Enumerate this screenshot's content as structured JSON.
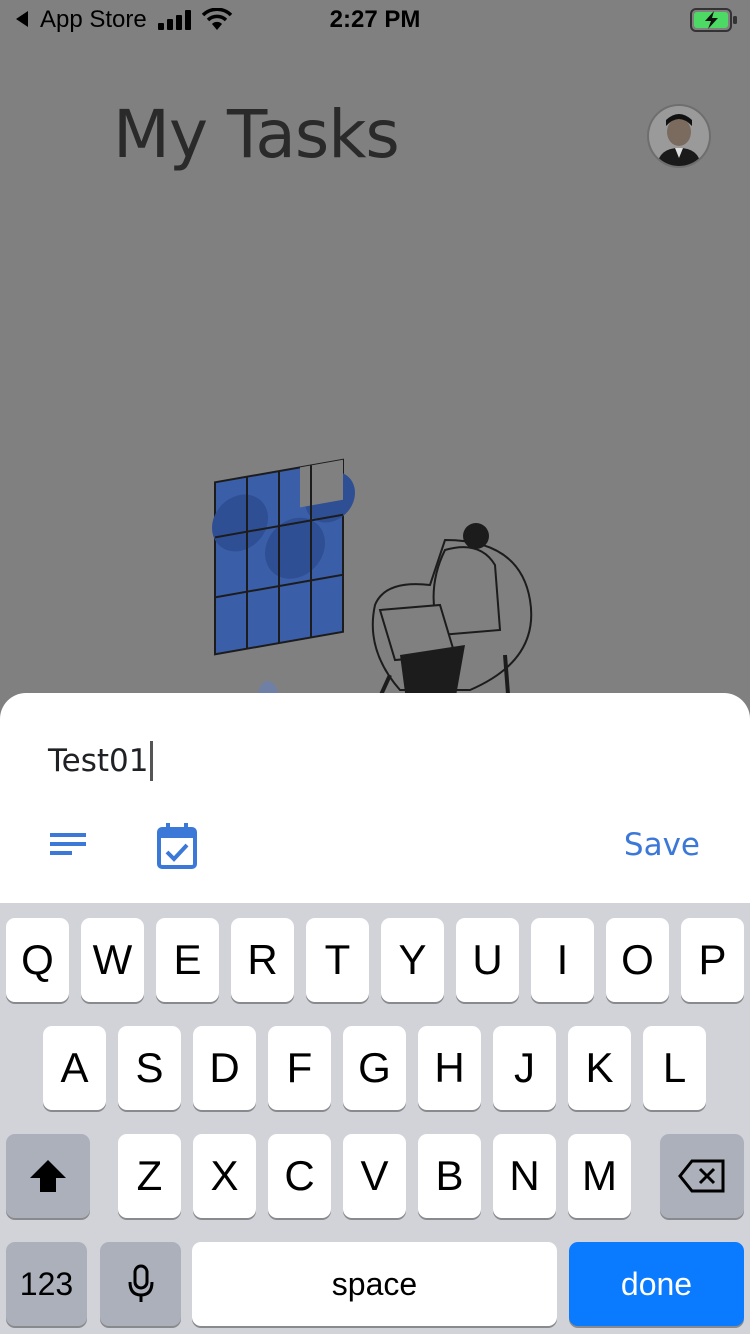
{
  "status_bar": {
    "back_app": "App Store",
    "time": "2:27 PM"
  },
  "page": {
    "title": "My Tasks"
  },
  "sheet": {
    "task_text": "Test01",
    "save_label": "Save"
  },
  "keyboard": {
    "row1": [
      "Q",
      "W",
      "E",
      "R",
      "T",
      "Y",
      "U",
      "I",
      "O",
      "P"
    ],
    "row2": [
      "A",
      "S",
      "D",
      "F",
      "G",
      "H",
      "J",
      "K",
      "L"
    ],
    "row3": [
      "Z",
      "X",
      "C",
      "V",
      "B",
      "N",
      "M"
    ],
    "numbers_label": "123",
    "space_label": "space",
    "done_label": "done"
  },
  "colors": {
    "accent": "#3b78d8",
    "done_key": "#0a7aff",
    "scrim": "#808080",
    "battery": "#4cd964"
  },
  "icons": [
    "back-arrow-icon",
    "signal-icon",
    "wifi-icon",
    "battery-icon",
    "details-lines-icon",
    "calendar-check-icon",
    "shift-icon",
    "mic-icon",
    "backspace-icon"
  ]
}
